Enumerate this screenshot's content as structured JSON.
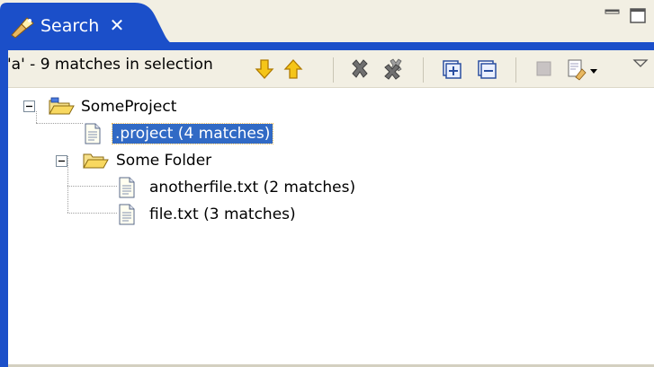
{
  "tab": {
    "label": "Search",
    "icon": "search-flashlight-icon",
    "close_icon": "close-icon",
    "close_glyph": "✕"
  },
  "window_controls": [
    "minimize-icon",
    "maximize-icon"
  ],
  "toolbar": {
    "status": "'a' - 9 matches in selection",
    "buttons": [
      "next-match-icon",
      "previous-match-icon",
      "remove-selected-matches-icon",
      "remove-all-matches-icon",
      "expand-all-icon",
      "collapse-all-icon",
      "cancel-search-icon",
      "search-history-icon",
      "view-menu-icon"
    ]
  },
  "tree": {
    "items": [
      {
        "label": "SomeProject",
        "icon": "open-project-icon"
      },
      {
        "label": ".project (4 matches)",
        "icon": "file-icon",
        "selected": true
      },
      {
        "label": "Some Folder",
        "icon": "open-folder-icon"
      },
      {
        "label": "anotherfile.txt (2 matches)",
        "icon": "file-icon"
      },
      {
        "label": "file.txt (3 matches)",
        "icon": "file-icon"
      }
    ]
  },
  "colors": {
    "active_tab": "#1b4fc9",
    "toolbar_bg": "#f2efe3",
    "selection": "#316ac5"
  }
}
